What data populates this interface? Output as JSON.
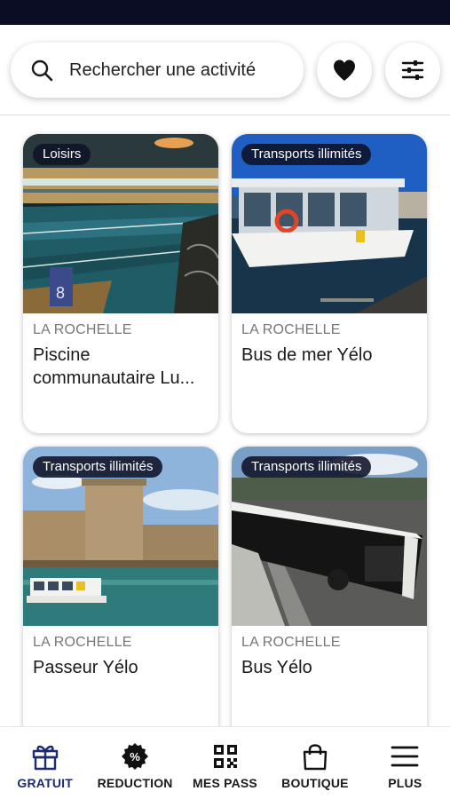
{
  "search": {
    "label": "Rechercher une activité",
    "icon": "search-icon"
  },
  "actions": {
    "favorites_icon": "heart-icon",
    "filters_icon": "sliders-icon"
  },
  "cards": [
    {
      "tag": "Loisirs",
      "city": "LA ROCHELLE",
      "title": "Piscine communautaire Lu..."
    },
    {
      "tag": "Transports illimités",
      "city": "LA ROCHELLE",
      "title": "Bus de mer Yélo"
    },
    {
      "tag": "Transports illimités",
      "city": "LA ROCHELLE",
      "title": "Passeur Yélo"
    },
    {
      "tag": "Transports illimités",
      "city": "LA ROCHELLE",
      "title": "Bus Yélo"
    }
  ],
  "nav": [
    {
      "label": "GRATUIT",
      "icon": "gift-icon",
      "active": true
    },
    {
      "label": "REDUCTION",
      "icon": "discount-badge-icon",
      "active": false
    },
    {
      "label": "MES PASS",
      "icon": "qr-code-icon",
      "active": false
    },
    {
      "label": "BOUTIQUE",
      "icon": "shopping-bag-icon",
      "active": false
    },
    {
      "label": "PLUS",
      "icon": "menu-icon",
      "active": false
    }
  ],
  "colors": {
    "status_bar": "#0a0d24",
    "accent_active": "#1c2a6e",
    "tag_bg": "#0f1228"
  }
}
